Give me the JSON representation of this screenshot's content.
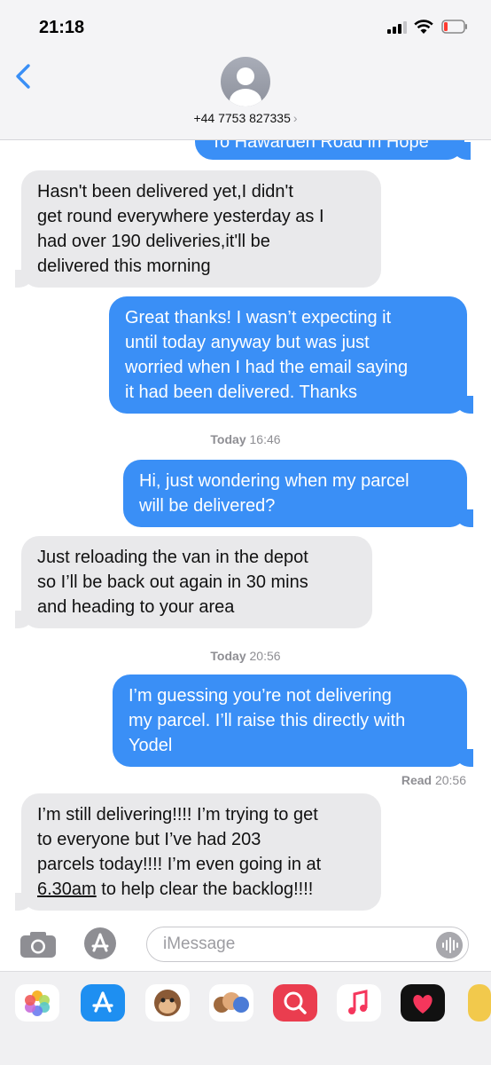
{
  "status_bar": {
    "time": "21:18"
  },
  "header": {
    "contact": "+44 7753 827335",
    "chevron": "›"
  },
  "thread": {
    "partial_bubble": "To Hawarden Road in Hope",
    "msg1_lines": [
      "Hasn't been delivered yet,I didn't",
      "get round everywhere yesterday as I",
      "had over 190 deliveries,it'll be",
      "delivered this morning"
    ],
    "msg2_lines": [
      "Great thanks! I wasn’t expecting it",
      "until today anyway but was just",
      "worried when I had the email saying",
      "it had been delivered. Thanks"
    ],
    "ts1_day": "Today",
    "ts1_time": "16:46",
    "msg3_lines": [
      "Hi, just wondering when my parcel",
      "will be delivered?"
    ],
    "msg4_lines": [
      "Just reloading the van in the depot",
      "so I’ll be back out again in 30 mins",
      "and heading to your area"
    ],
    "ts2_day": "Today",
    "ts2_time": "20:56",
    "msg5_lines": [
      "I’m guessing you’re not delivering",
      "my parcel. I’ll raise this directly with",
      "Yodel"
    ],
    "read_label": "Read",
    "read_time": "20:56",
    "msg6_lines": [
      "I’m still delivering!!!! I’m trying to get",
      "to everyone but I’ve had 203",
      "parcels today!!!! I’m even going in at"
    ],
    "msg6_link": "6.30am",
    "msg6_tail": " to help clear the backlog!!!!"
  },
  "composer": {
    "placeholder": "iMessage"
  },
  "icons": {
    "back": "chevron-left-icon",
    "camera": "camera-icon",
    "apps": "app-store-icon",
    "mic": "audio-waveform-icon"
  },
  "colors": {
    "outgoing": "#3a8ff6",
    "incoming": "#e9e9eb",
    "accent": "#3a8ff6"
  }
}
